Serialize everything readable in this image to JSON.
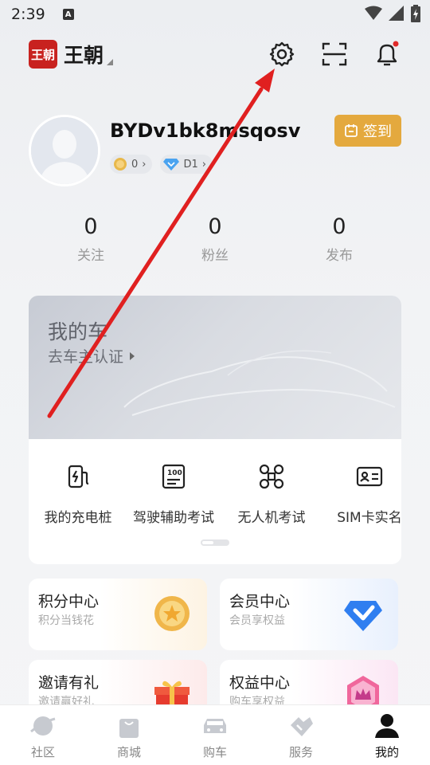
{
  "status_bar": {
    "time": "2:39",
    "notif_letter": "A"
  },
  "header": {
    "brand_logo": "王朝",
    "brand_name": "王朝"
  },
  "profile": {
    "username": "BYDv1bk8msqosv",
    "points_badge": "0",
    "level_badge": "D1",
    "signin_label": "签到"
  },
  "stats": [
    {
      "value": "0",
      "label": "关注"
    },
    {
      "value": "0",
      "label": "粉丝"
    },
    {
      "value": "0",
      "label": "发布"
    }
  ],
  "my_car": {
    "title": "我的车",
    "subtitle": "去车主认证",
    "services": [
      {
        "label": "我的充电桩",
        "icon": "charging-pile-icon"
      },
      {
        "label": "驾驶辅助考试",
        "icon": "exam-score-icon"
      },
      {
        "label": "无人机考试",
        "icon": "drone-icon"
      },
      {
        "label": "SIM卡实名",
        "icon": "id-card-icon"
      }
    ]
  },
  "tiles": [
    {
      "title": "积分中心",
      "subtitle": "积分当钱花",
      "icon": "gold-coin-icon"
    },
    {
      "title": "会员中心",
      "subtitle": "会员享权益",
      "icon": "blue-diamond-icon"
    },
    {
      "title": "邀请有礼",
      "subtitle": "邀请赢好礼",
      "icon": "gift-box-icon"
    },
    {
      "title": "权益中心",
      "subtitle": "购车享权益",
      "icon": "crown-badge-icon"
    }
  ],
  "tabs": [
    {
      "label": "社区",
      "icon": "planet-icon"
    },
    {
      "label": "商城",
      "icon": "shopping-bag-icon"
    },
    {
      "label": "购车",
      "icon": "car-icon"
    },
    {
      "label": "服务",
      "icon": "handshake-icon"
    },
    {
      "label": "我的",
      "icon": "person-icon",
      "active": true
    }
  ],
  "colors": {
    "brand_red": "#c8221f",
    "signin_gold": "#e4a93e",
    "annotation_arrow": "#e02020"
  }
}
